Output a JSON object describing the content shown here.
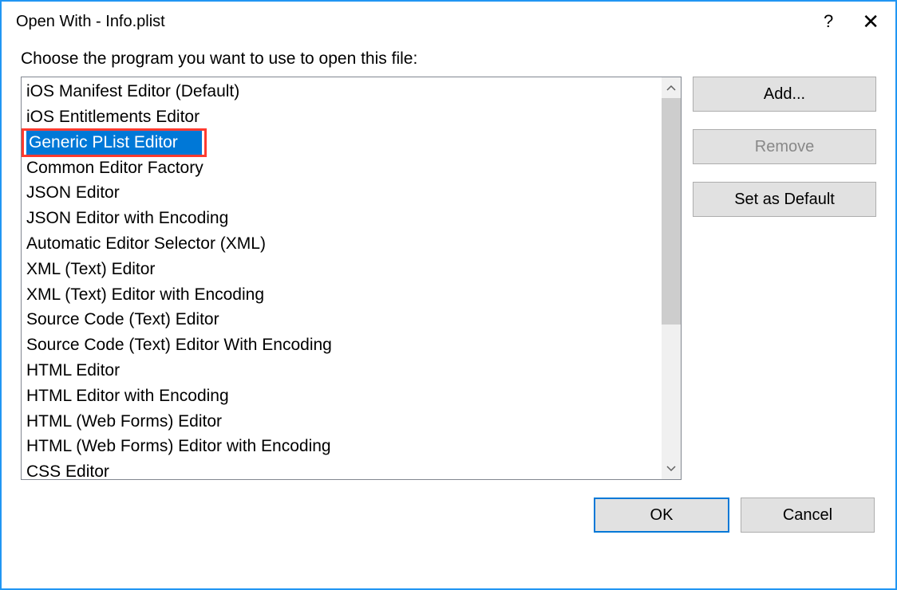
{
  "titlebar": {
    "title": "Open With - Info.plist",
    "help_glyph": "?",
    "close_glyph": "✕"
  },
  "prompt": "Choose the program you want to use to open this file:",
  "list": {
    "items": [
      {
        "label": "iOS Manifest Editor (Default)",
        "selected": false,
        "highlighted": false
      },
      {
        "label": "iOS Entitlements Editor",
        "selected": false,
        "highlighted": false
      },
      {
        "label": "Generic PList Editor",
        "selected": true,
        "highlighted": true
      },
      {
        "label": "Common Editor Factory",
        "selected": false,
        "highlighted": false
      },
      {
        "label": "JSON Editor",
        "selected": false,
        "highlighted": false
      },
      {
        "label": "JSON Editor with Encoding",
        "selected": false,
        "highlighted": false
      },
      {
        "label": "Automatic Editor Selector (XML)",
        "selected": false,
        "highlighted": false
      },
      {
        "label": "XML (Text) Editor",
        "selected": false,
        "highlighted": false
      },
      {
        "label": "XML (Text) Editor with Encoding",
        "selected": false,
        "highlighted": false
      },
      {
        "label": "Source Code (Text) Editor",
        "selected": false,
        "highlighted": false
      },
      {
        "label": "Source Code (Text) Editor With Encoding",
        "selected": false,
        "highlighted": false
      },
      {
        "label": "HTML Editor",
        "selected": false,
        "highlighted": false
      },
      {
        "label": "HTML Editor with Encoding",
        "selected": false,
        "highlighted": false
      },
      {
        "label": "HTML (Web Forms) Editor",
        "selected": false,
        "highlighted": false
      },
      {
        "label": "HTML (Web Forms) Editor with Encoding",
        "selected": false,
        "highlighted": false
      },
      {
        "label": "CSS Editor",
        "selected": false,
        "highlighted": false
      }
    ]
  },
  "side_buttons": {
    "add": "Add...",
    "remove": "Remove",
    "set_default": "Set as Default"
  },
  "bottom_buttons": {
    "ok": "OK",
    "cancel": "Cancel"
  },
  "scroll": {
    "up_glyph": "⌃",
    "down_glyph": "⌄"
  }
}
